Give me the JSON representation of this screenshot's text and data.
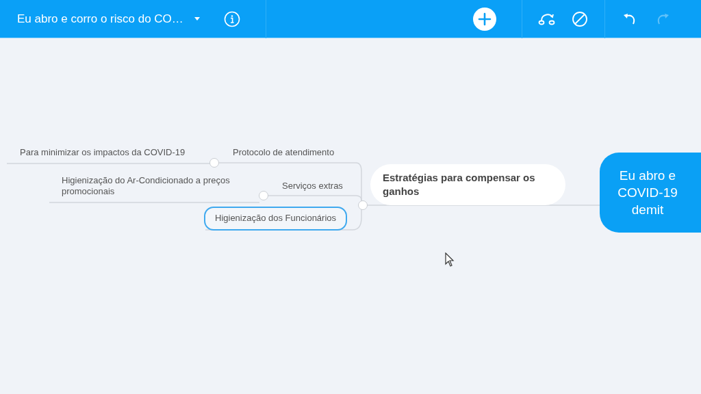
{
  "toolbar": {
    "title": "Eu abro e corro o risco do CO…",
    "buttons": [
      {
        "kind": "info",
        "disabled": false
      },
      {
        "kind": "add",
        "disabled": false
      },
      {
        "kind": "relationship",
        "disabled": false
      },
      {
        "kind": "no-style",
        "disabled": false
      },
      {
        "kind": "undo",
        "disabled": false
      },
      {
        "kind": "redo",
        "disabled": true
      }
    ]
  },
  "map": {
    "root": {
      "lines": [
        "Eu abro e",
        "COVID-19",
        "demit"
      ]
    },
    "branch": {
      "text": "Estratégias para compensar os ganhos",
      "selected": false,
      "children": [
        {
          "text": "Protocolo de atendimento",
          "selected": false,
          "children": [
            {
              "text": "Para minimizar os impactos da COVID-19",
              "selected": false
            }
          ]
        },
        {
          "text": "Serviços extras",
          "selected": false,
          "children": [
            {
              "text": "Higienização do Ar-Condicionado a preços promocionais",
              "selected": false
            }
          ]
        },
        {
          "text": "Higienização dos Funcionários",
          "selected": true
        }
      ]
    }
  }
}
